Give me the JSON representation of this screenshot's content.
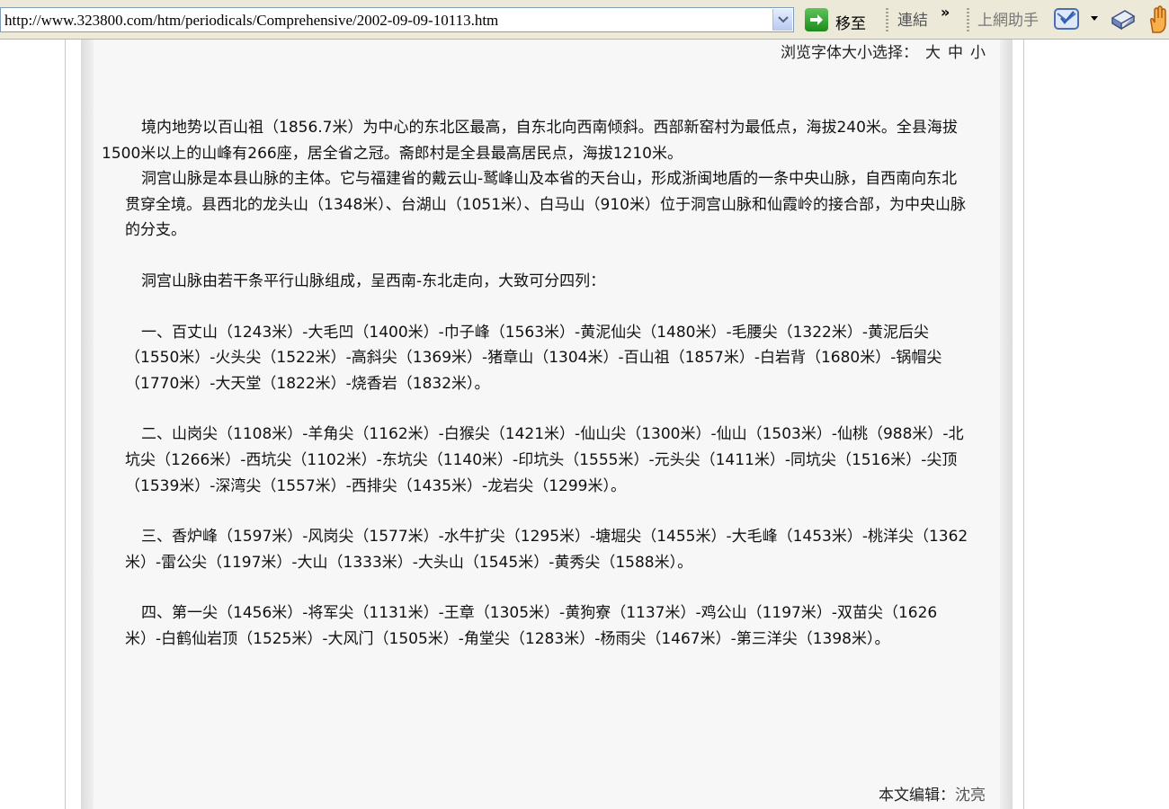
{
  "browser": {
    "url": "http://www.323800.com/htm/periodicals/Comprehensive/2002-09-09-10113.htm",
    "go_label": "移至",
    "links_label": "連結",
    "links_chevron": "»",
    "helper_label": "上網助手"
  },
  "page": {
    "font_size_label": "浏览字体大小选择：",
    "font_sizes": [
      "大",
      "中",
      "小"
    ],
    "paragraphs": [
      "境内地势以百山祖（1856.7米）为中心的东北区最高，自东北向西南倾斜。西部新窑村为最低点，海拔240米。全县海拔1500米以上的山峰有266座，居全省之冠。斋郎村是全县最高居民点，海拔1210米。",
      "洞宫山脉是本县山脉的主体。它与福建省的戴云山-鹫峰山及本省的天台山，形成浙闽地盾的一条中央山脉，自西南向东北贯穿全境。县西北的龙头山（1348米）、台湖山（1051米）、白马山（910米）位于洞宫山脉和仙霞岭的接合部，为中央山脉的分支。",
      "洞宫山脉由若干条平行山脉组成，呈西南-东北走向，大致可分四列：",
      "一、百丈山（1243米）-大毛凹（1400米）-巾子峰（1563米）-黄泥仙尖（1480米）-毛腰尖（1322米）-黄泥后尖（1550米）-火头尖（1522米）-高斜尖（1369米）-猪章山（1304米）-百山祖（1857米）-白岩背（1680米）-锅帽尖（1770米）-大天堂（1822米）-烧香岩（1832米）。",
      "二、山岗尖（1108米）-羊角尖（1162米）-白猴尖（1421米）-仙山尖（1300米）-仙山（1503米）-仙桃（988米）-北坑尖（1266米）-西坑尖（1102米）-东坑尖（1140米）-印坑头（1555米）-元头尖（1411米）-同坑尖（1516米）-尖顶（1539米）-深湾尖（1557米）-西排尖（1435米）-龙岩尖（1299米）。",
      "三、香炉峰（1597米）-风岗尖（1577米）-水牛扩尖（1295米）-塘堀尖（1455米）-大毛峰（1453米）-桃洋尖（1362米）-雷公尖（1197米）-大山（1333米）-大头山（1545米）-黄秀尖（1588米）。",
      "四、第一尖（1456米）-将军尖（1131米）-王章（1305米）-黄狗寮（1137米）-鸡公山（1197米）-双苗尖（1626米）-白鹤仙岩顶（1525米）-大风门（1505米）-角堂尖（1283米）-杨雨尖（1467米）-第三洋尖（1398米）。"
    ],
    "editor_label": "本文编辑：",
    "editor_name": "沈亮"
  }
}
